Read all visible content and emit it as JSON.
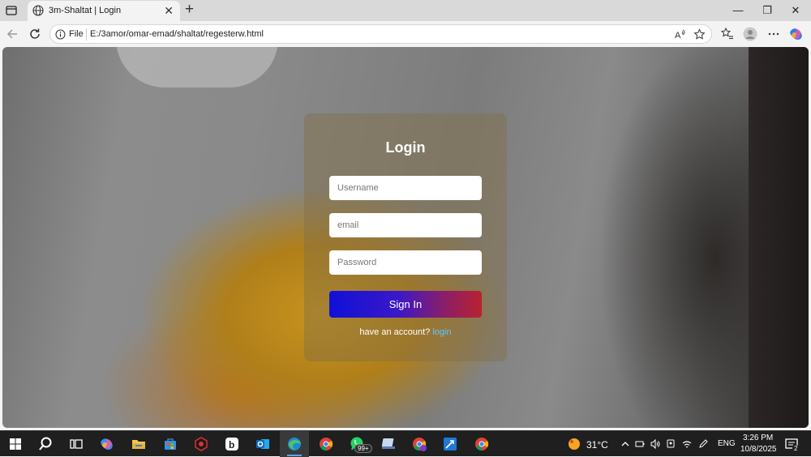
{
  "browser": {
    "tab_title": "3m-Shaltat | Login",
    "url_scheme_label": "File",
    "url": "E:/3amor/omar-emad/shaltat/regesterw.html",
    "window_controls": [
      "—",
      "❐",
      "✕"
    ],
    "new_tab_symbol": "+",
    "tab_close_symbol": "✕"
  },
  "page": {
    "title": "Login",
    "username_placeholder": "Username",
    "email_placeholder": "email",
    "password_placeholder": "Password",
    "signin_label": "Sign In",
    "account_prompt": "have an account? ",
    "account_link": "login",
    "colors": {
      "button_gradient_start": "#1010d8",
      "button_gradient_end": "#b8222e",
      "link": "#5ec8ff"
    }
  },
  "taskbar": {
    "weather_temp": "31°C",
    "language": "ENG",
    "time": "3:26 PM",
    "date": "10/8/2025",
    "whatsapp_badge": "99+",
    "notification_count": "2",
    "apps": [
      "start-icon",
      "search-icon",
      "task-view-icon",
      "copilot-icon",
      "file-explorer-icon",
      "store-icon",
      "app-red-icon",
      "app-b-icon",
      "outlook-icon",
      "edge-icon",
      "chrome-icon",
      "whatsapp-icon",
      "app-terminal-icon",
      "chrome-profile-icon",
      "app-blue-icon",
      "chrome-alt-icon"
    ]
  }
}
